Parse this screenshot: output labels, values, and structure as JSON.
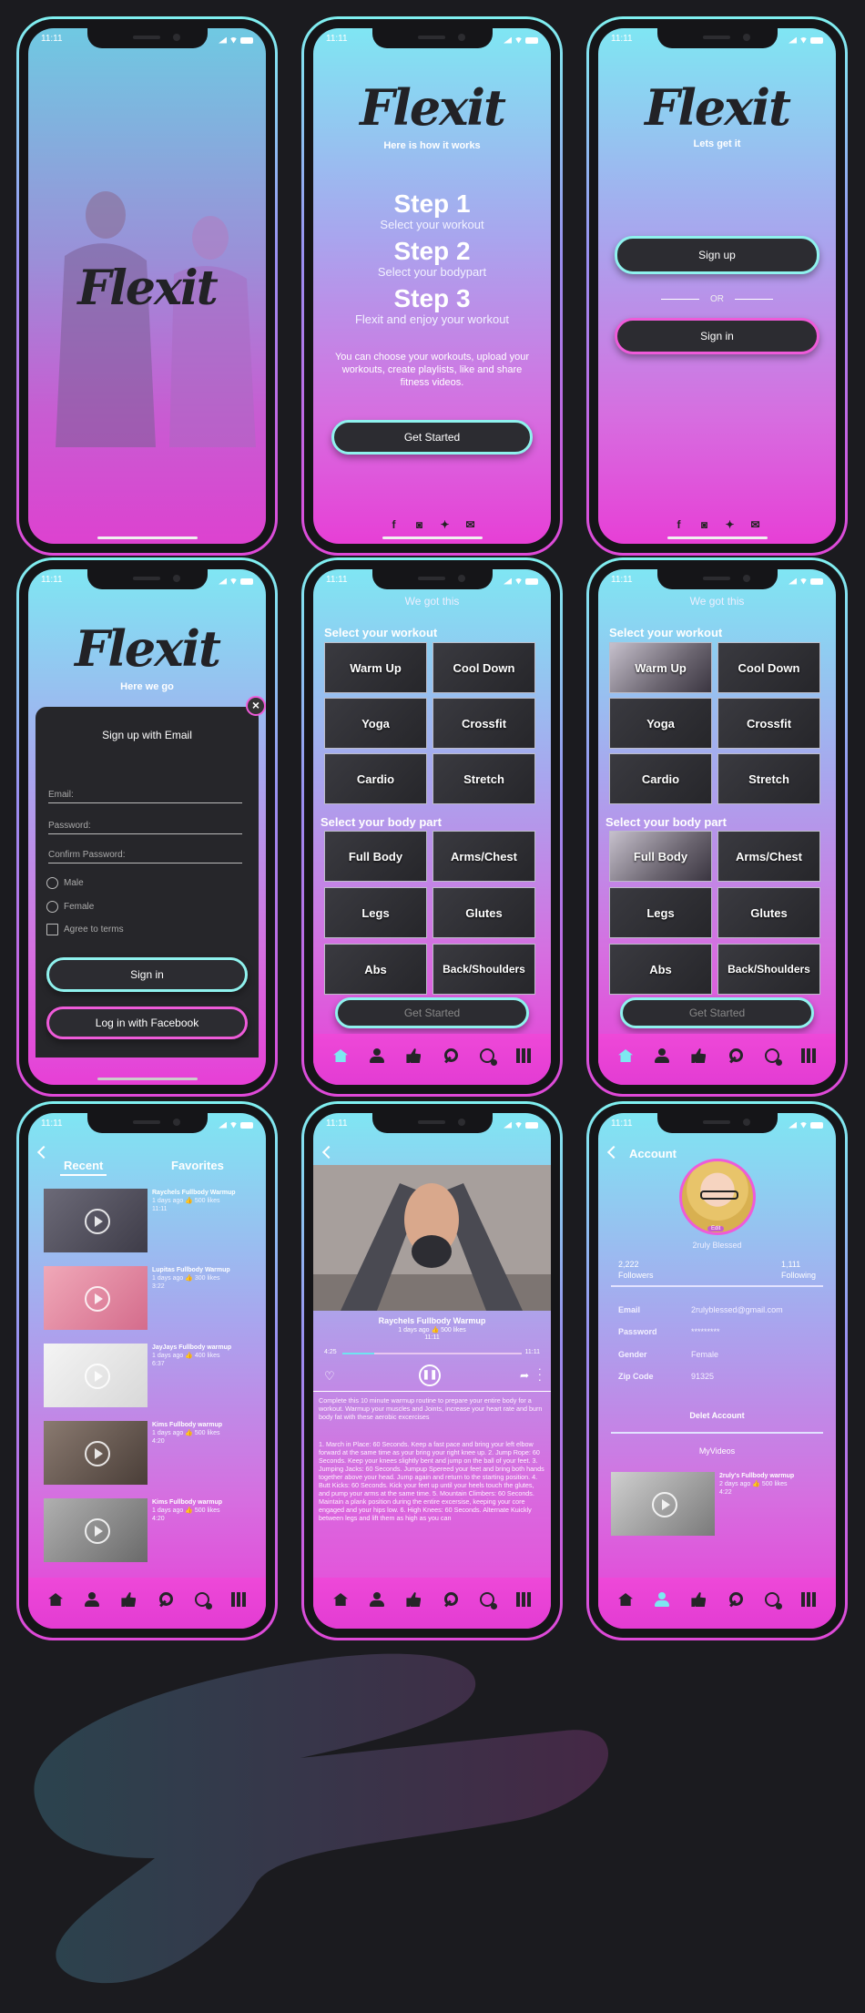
{
  "status_time": "11:11",
  "brand": "Flexit",
  "social_icons": [
    "facebook-icon",
    "instagram-icon",
    "twitter-icon",
    "mail-icon"
  ],
  "colors": {
    "background": "#1b1b1f",
    "accent_cyan": "#8ff2ee",
    "accent_pink": "#ee5bd9",
    "button_dark": "#2c2c31"
  },
  "splash": {},
  "howto": {
    "subtitle": "Here is how it works",
    "steps": [
      {
        "title": "Step 1",
        "text": "Select your workout"
      },
      {
        "title": "Step 2",
        "text": "Select your bodypart"
      },
      {
        "title": "Step 3",
        "text": "Flexit and enjoy your workout"
      }
    ],
    "description": "You can choose your workouts, upload your workouts, create playlists, like and share fitness videos.",
    "cta": "Get Started"
  },
  "auth": {
    "subtitle": "Lets get it",
    "signup": "Sign up",
    "or": "OR",
    "signin": "Sign in"
  },
  "signup": {
    "subtitle": "Here we go",
    "title": "Sign up with Email",
    "email": "Email:",
    "password": "Password:",
    "confirm": "Confirm Password:",
    "male": "Male",
    "female": "Female",
    "terms": "Agree to terms",
    "signin": "Sign in",
    "facebook": "Log in with Facebook"
  },
  "select": {
    "header": "We got this",
    "workout_title": "Select your workout",
    "workouts": [
      "Warm Up",
      "Cool Down",
      "Yoga",
      "Crossfit",
      "Cardio",
      "Stretch"
    ],
    "body_title": "Select your body part",
    "bodyparts": [
      "Full Body",
      "Arms/Chest",
      "Legs",
      "Glutes",
      "Abs",
      "Back/Shoulders"
    ],
    "cta": "Get Started"
  },
  "recent": {
    "tabs": [
      "Recent",
      "Favorites"
    ],
    "items": [
      {
        "title": "Raychels Fullbody Warmup",
        "meta": "1 days ago  👍 500 likes",
        "dur": "11:11"
      },
      {
        "title": "Lupitas Fullbody Warmup",
        "meta": "1 days ago  👍 300 likes",
        "dur": "3:22"
      },
      {
        "title": "JayJays Fullbody warmup",
        "meta": "1 days ago  👍 400 likes",
        "dur": "6:37"
      },
      {
        "title": "Kims Fullbody warmup",
        "meta": "1 days ago  👍 500 likes",
        "dur": "4:20"
      },
      {
        "title": "Kims Fullbody warmup",
        "meta": "1 days ago  👍 500 likes",
        "dur": "4:20"
      }
    ]
  },
  "player": {
    "title": "Raychels Fullbody Warmup",
    "meta": "1 days ago  👍 500 likes",
    "duration": "11:11",
    "elapsed": "4:25",
    "total": "11:11",
    "progress": 0.18,
    "description": "Complete this 10 minute warmup routine to prepare your entire body for a workout. Warmup your muscles and Joints, increase your heart rate and burn body fat with these aerobic excercises",
    "steps": "1. March in Place: 60 Seconds. Keep a fast pace and bring your left elbow forward at the same time as your bring your right knee up. 2. Jump Rope: 60 Seconds. Keep your knees slightly bent and jump on the ball of your feet. 3. Jumping Jacks: 60 Seconds. Jumpup Spereed your feet and bring both hands together above your head. Jump again and return to the starting position. 4. Butt Kicks: 60 Seconds. Kick your feet up until your heels touch the glutes, and pump your arms at the same time. 5. Mountain Climbers: 60 Seconds. Maintain a plank position during the entire excersise, keeping your core engaged and your hips low. 6. High Knees: 60 Seconds. Alternate Kuickly between legs and lift them as high as you can"
  },
  "account": {
    "title": "Account",
    "username": "2ruly Blessed",
    "badge": "Edit",
    "followers_count": "2,222",
    "followers_label": "Followers",
    "following_count": "1,111",
    "following_label": "Following",
    "fields": [
      {
        "k": "Email",
        "v": "2rulyblessed@gmail.com"
      },
      {
        "k": "Password",
        "v": "*********"
      },
      {
        "k": "Gender",
        "v": "Female"
      },
      {
        "k": "Zip Code",
        "v": "91325"
      }
    ],
    "delete": "Delet Account",
    "myvideos": "MyVideos",
    "video": {
      "title": "2ruly's Fullbody warmup",
      "meta": "2 days ago  👍 500 likes",
      "dur": "4:22"
    }
  }
}
